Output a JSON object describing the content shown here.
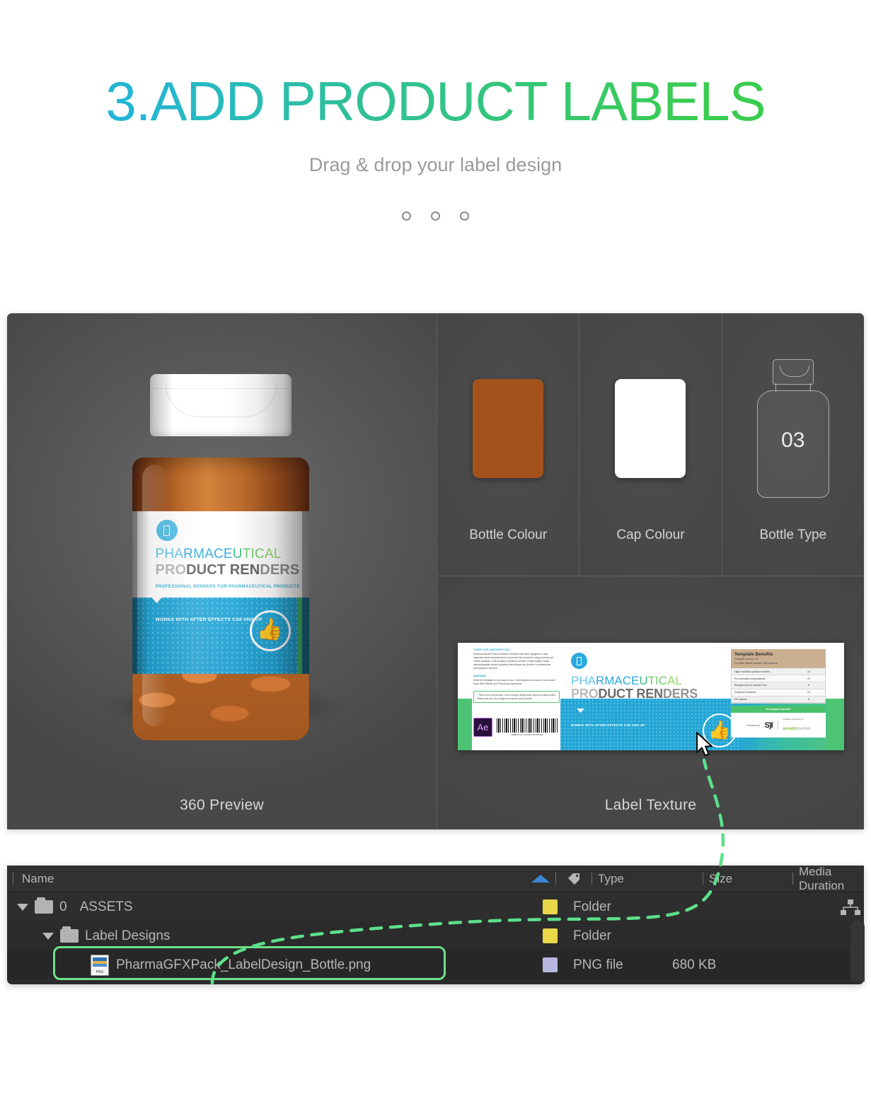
{
  "hero": {
    "title": "3.ADD PRODUCT LABELS",
    "subtitle": "Drag & drop your label design",
    "accent_blue": "#26b0e2",
    "accent_green": "#3acc50"
  },
  "stage": {
    "preview": {
      "caption": "360 Preview"
    },
    "options": [
      {
        "name": "bottle-colour",
        "label": "Bottle Colour",
        "swatch": "#a4521c"
      },
      {
        "name": "cap-colour",
        "label": "Cap Colour",
        "swatch": "#ffffff"
      },
      {
        "name": "bottle-type",
        "label": "Bottle Type",
        "value": "03"
      }
    ],
    "texture": {
      "caption": "Label  Texture"
    }
  },
  "bottle_label": {
    "title_line1": [
      {
        "t": "PHA",
        "c": "c1"
      },
      {
        "t": "RMACE",
        "c": "c2"
      },
      {
        "t": "U",
        "c": "c3"
      },
      {
        "t": "TIC",
        "c": "c4"
      },
      {
        "t": "AL",
        "c": "c5"
      }
    ],
    "title_line2": [
      {
        "t": "PRO",
        "c": "g1"
      },
      {
        "t": "DUCT ",
        "c": "g2"
      },
      {
        "t": "REN",
        "c": "g2"
      },
      {
        "t": "DERS",
        "c": "g3"
      }
    ],
    "subtitle": "PROFESSIONAL RENDERS FOR PHARMACEUTICAL PRODUCTS",
    "works_with": "WORKS WITH AFTER EFFECTS CS6 AND UP"
  },
  "label_texture": {
    "description_heading": "TEMPLATE DESCRIPTION",
    "description_body": "Pharmaceutical Product Renders Template has been designed to help pharmaceutical manufacturers to promote their products using professional motion graphics. This template includes a number of high quality, easily interchangeable motion graphics that will give any product a professional presentation it deserve.",
    "warning_heading": "WARNING",
    "warning_body": "While the template is very easy to use, it still requires the users to have some basic After Effects and Photoshop experience.",
    "note": "* This is not a real product. Just a mockup design that's used as a place-holder. Please use your own designs to promote your products.",
    "ae_badge": "Ae",
    "barcode_number": "93880 3 (17) 140794 (10) AB-123",
    "benefits_title": "Template Benefits",
    "benefits_sub1": "Template version 1.0",
    "benefits_sub2": "For After Effects version CS5.5 and up",
    "benefits_rows": [
      {
        "label": "High resolution product renders",
        "value": "10"
      },
      {
        "label": "Pre-animated compositions",
        "value": "10"
      },
      {
        "label": "Backgrounds to choose from",
        "value": "6"
      },
      {
        "label": "Graphics Elements",
        "value": "14"
      },
      {
        "label": "Pill options",
        "value": "5"
      }
    ],
    "badge": "No plugins required!",
    "produced_by_label": "Produced by",
    "produced_by_mark": "S)l",
    "available_label": "Available exclusively on",
    "market_brand_1": "envato",
    "market_brand_2": "market"
  },
  "browser": {
    "columns": [
      {
        "key": "name",
        "label": "Name"
      },
      {
        "key": "type",
        "label": "Type"
      },
      {
        "key": "size",
        "label": "Size"
      },
      {
        "key": "duration",
        "label": "Media Duration"
      }
    ],
    "rows": [
      {
        "indent": 0,
        "expanded": true,
        "icon": "folder-icon",
        "index": "0",
        "name": "ASSETS",
        "type": "Folder",
        "size": "",
        "duration": ""
      },
      {
        "indent": 1,
        "expanded": true,
        "icon": "folder-icon",
        "index": "",
        "name": "Label Designs",
        "type": "Folder",
        "size": "",
        "duration": ""
      },
      {
        "indent": 2,
        "expanded": false,
        "icon": "png-file-icon",
        "index": "",
        "name": "PharmaGFXPack_LabelDesign_Bottle.png",
        "type": "PNG file",
        "size": "680 KB",
        "duration": ""
      }
    ],
    "selection_color": "#6fe08a"
  }
}
